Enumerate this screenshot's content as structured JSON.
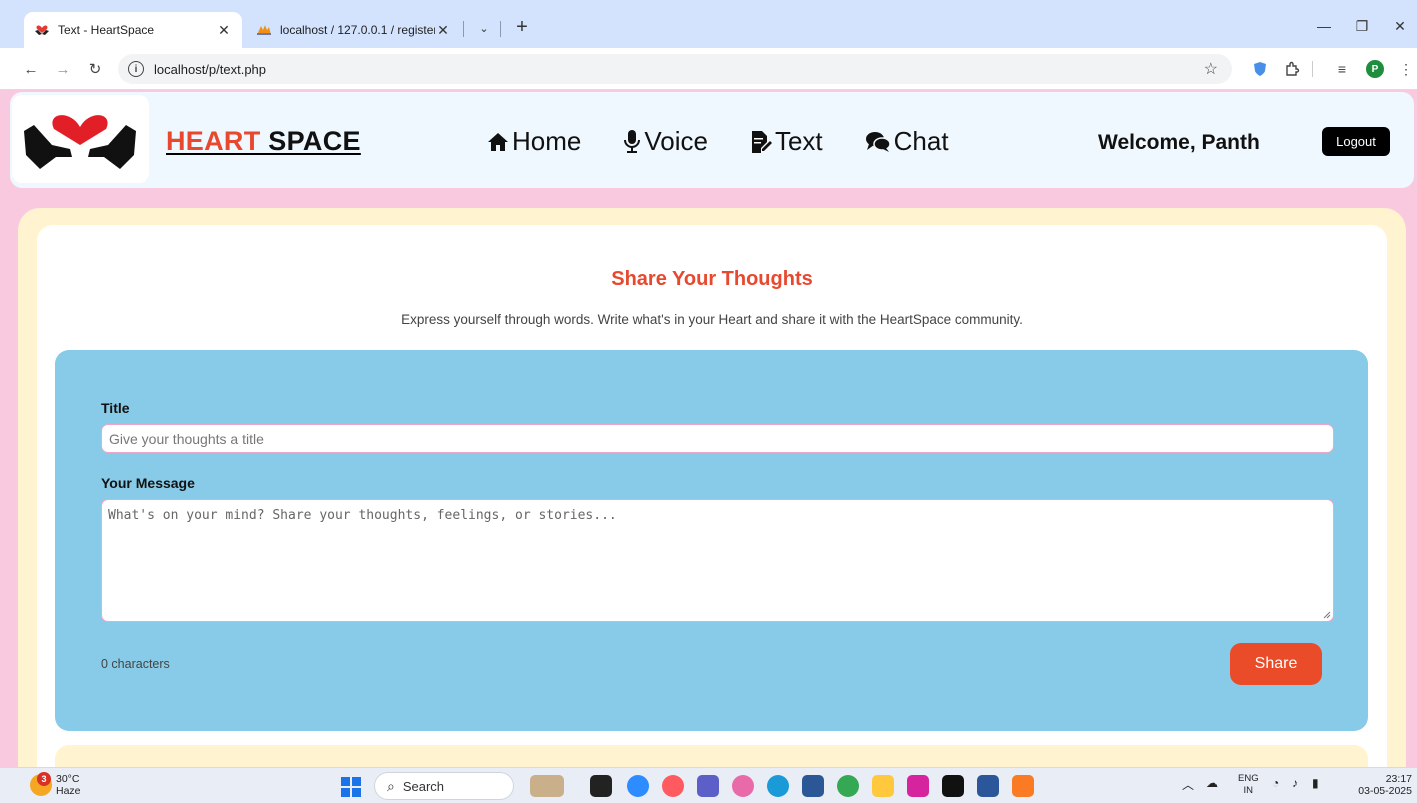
{
  "browser": {
    "tabs": [
      {
        "title": "Text - HeartSpace",
        "active": true
      },
      {
        "title": "localhost / 127.0.0.1 / register /",
        "active": false
      }
    ],
    "url": "localhost/p/text.php",
    "profile_initial": "P"
  },
  "header": {
    "brand_part1": "HEART",
    "brand_part2": " SPACE",
    "nav": [
      {
        "label": "Home",
        "icon": "home-icon"
      },
      {
        "label": "Voice",
        "icon": "microphone-icon"
      },
      {
        "label": "Text",
        "icon": "document-edit-icon"
      },
      {
        "label": "Chat",
        "icon": "chat-bubbles-icon"
      }
    ],
    "welcome": "Welcome, Panth",
    "logout_label": "Logout"
  },
  "main": {
    "title": "Share Your Thoughts",
    "subtitle": "Express yourself through words. Write what's in your Heart and share it with the HeartSpace community.",
    "form": {
      "title_label": "Title",
      "title_placeholder": "Give your thoughts a title",
      "message_label": "Your Message",
      "message_placeholder": "What's on your mind? Share your thoughts, feelings, or stories...",
      "char_count": "0 characters",
      "share_label": "Share"
    }
  },
  "colors": {
    "accent": "#e8482e",
    "page_bg": "#f9c9e0",
    "header_bg": "#f0f8ff",
    "form_bg": "#87cbe8",
    "card_bg": "#fff3d0"
  },
  "taskbar": {
    "weather_temp": "30°C",
    "weather_desc": "Haze",
    "weather_badge": "3",
    "search_label": "Search",
    "lang_1": "ENG",
    "lang_2": "IN",
    "time": "23:17",
    "date": "03-05-2025"
  }
}
